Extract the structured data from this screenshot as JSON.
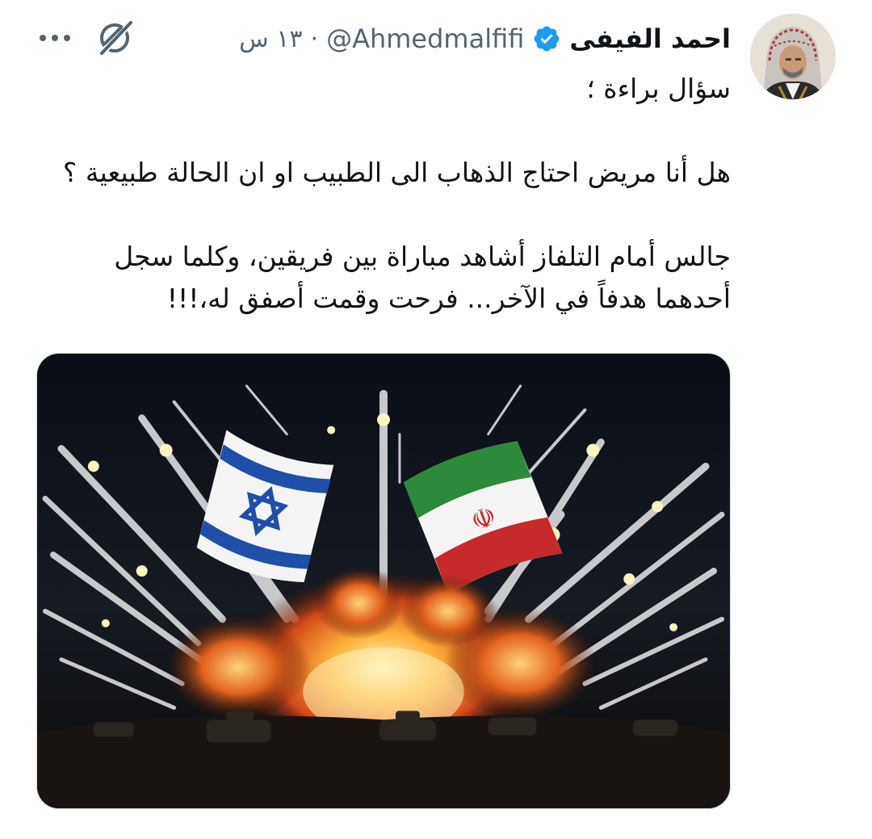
{
  "tweet": {
    "author": {
      "display_name": "احمد الفيفى",
      "handle": "@Ahmedmalfifi",
      "verified": true,
      "avatar": "avatar-photo"
    },
    "separator": "·",
    "timestamp": "١٣ س",
    "text": {
      "line1": "سؤال براءة ؛",
      "line2": "هل أنا مريض احتاج الذهاب الى الطبيب او ان الحالة طبيعية ؟",
      "line3": "جالس أمام التلفاز أشاهد مباراة بين فريقين، وكلما سجل",
      "line4": "أحدهما هدفاً في الآخر... فرحت وقمت أصفق له،!!!"
    },
    "media": {
      "type": "image",
      "description_icon": "image"
    },
    "icons": {
      "verified": "verified-badge-icon",
      "grok": "grok-icon",
      "more": "more-icon"
    },
    "colors": {
      "text": "#0f1419",
      "secondary": "#536471",
      "verified": "#1d9bf0"
    }
  }
}
